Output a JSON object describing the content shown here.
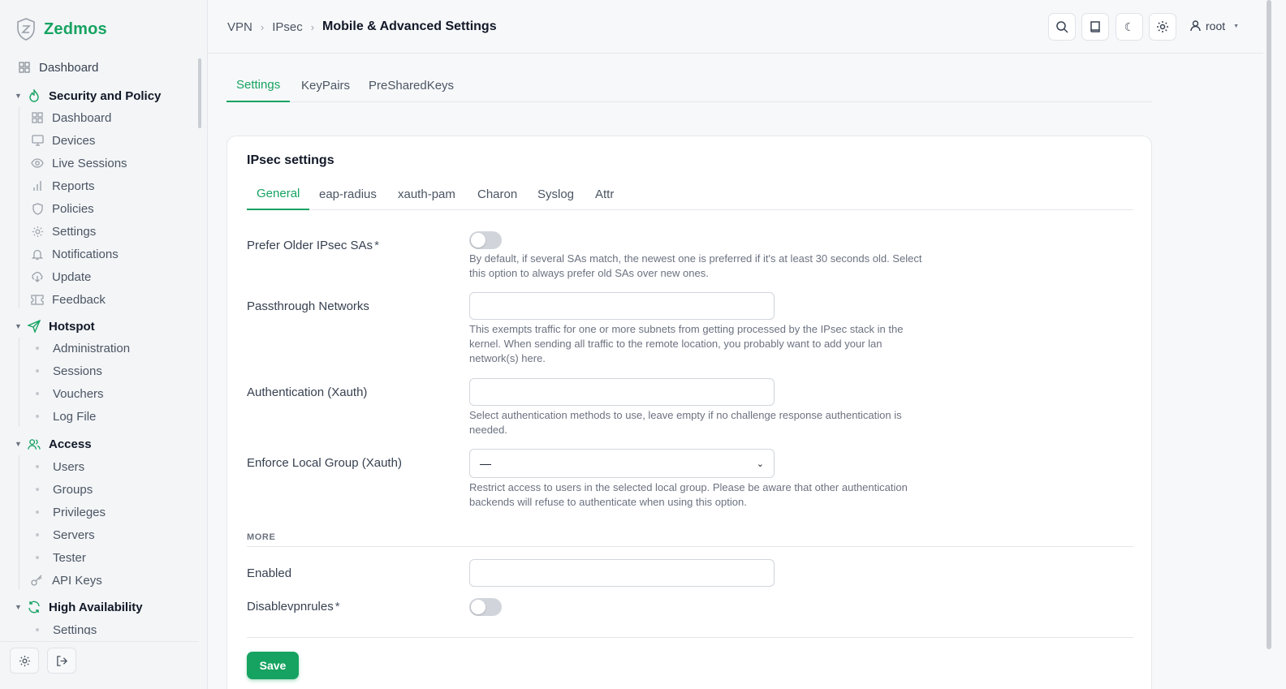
{
  "brand": {
    "name": "Zedmos"
  },
  "sidebar": {
    "top_item": {
      "label": "Dashboard",
      "icon": "grid-icon"
    },
    "groups": [
      {
        "label": "Security and Policy",
        "icon": "flame-icon",
        "items": [
          {
            "label": "Dashboard",
            "icon": "grid-icon"
          },
          {
            "label": "Devices",
            "icon": "monitor-icon"
          },
          {
            "label": "Live Sessions",
            "icon": "eye-icon"
          },
          {
            "label": "Reports",
            "icon": "bar-chart-icon"
          },
          {
            "label": "Policies",
            "icon": "shield-icon"
          },
          {
            "label": "Settings",
            "icon": "gear-icon"
          },
          {
            "label": "Notifications",
            "icon": "bell-icon"
          },
          {
            "label": "Update",
            "icon": "cloud-download-icon"
          },
          {
            "label": "Feedback",
            "icon": "ticket-icon"
          }
        ]
      },
      {
        "label": "Hotspot",
        "icon": "send-icon",
        "items": [
          {
            "label": "Administration"
          },
          {
            "label": "Sessions"
          },
          {
            "label": "Vouchers"
          },
          {
            "label": "Log File"
          }
        ]
      },
      {
        "label": "Access",
        "icon": "users-icon",
        "items": [
          {
            "label": "Users"
          },
          {
            "label": "Groups"
          },
          {
            "label": "Privileges"
          },
          {
            "label": "Servers"
          },
          {
            "label": "Tester"
          },
          {
            "label": "API Keys",
            "icon": "key-icon"
          }
        ]
      },
      {
        "label": "High Availability",
        "icon": "refresh-icon",
        "items": [
          {
            "label": "Settings"
          }
        ]
      }
    ]
  },
  "header": {
    "breadcrumb": [
      "VPN",
      "IPsec",
      "Mobile & Advanced Settings"
    ],
    "user": "root"
  },
  "tabs_top": [
    "Settings",
    "KeyPairs",
    "PreSharedKeys"
  ],
  "card": {
    "title": "IPsec settings",
    "tabs": [
      "General",
      "eap-radius",
      "xauth-pam",
      "Charon",
      "Syslog",
      "Attr"
    ],
    "fields": {
      "prefer_older": {
        "label": "Prefer Older IPsec SAs",
        "required": "*",
        "enabled": false,
        "help": "By default, if several SAs match, the newest one is preferred if it's at least 30 seconds old. Select this option to always prefer old SAs over new ones."
      },
      "passthrough": {
        "label": "Passthrough Networks",
        "value": "",
        "help": "This exempts traffic for one or more subnets from getting processed by the IPsec stack in the kernel. When sending all traffic to the remote location, you probably want to add your lan network(s) here."
      },
      "auth_xauth": {
        "label": "Authentication (Xauth)",
        "value": "",
        "help": "Select authentication methods to use, leave empty if no challenge response authentication is needed."
      },
      "local_group": {
        "label": "Enforce Local Group (Xauth)",
        "selected": "—",
        "help": "Restrict access to users in the selected local group. Please be aware that other authentication backends will refuse to authenticate when using this option."
      },
      "more_section": "MORE",
      "enabled": {
        "label": "Enabled",
        "value": ""
      },
      "disablevpnrules": {
        "label": "Disablevpnrules",
        "required": "*",
        "enabled": false
      }
    },
    "save_label": "Save"
  },
  "colors": {
    "accent": "#16a361"
  }
}
